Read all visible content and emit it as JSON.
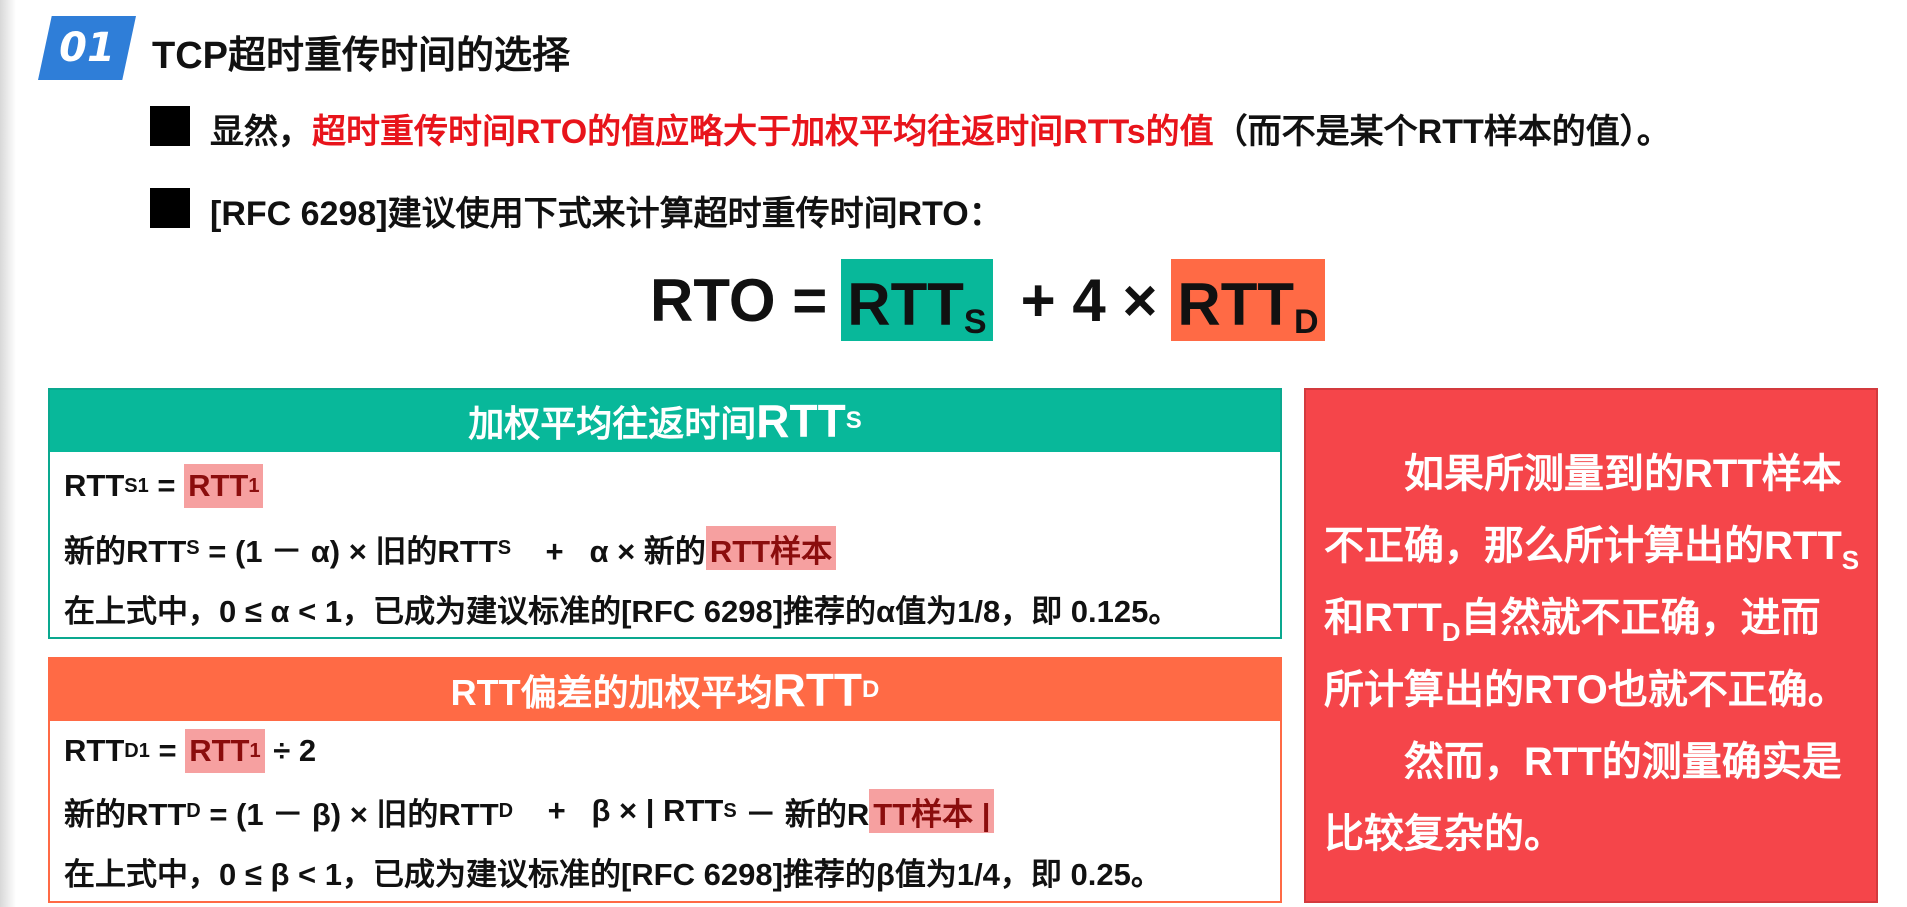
{
  "header": {
    "badge": "01",
    "title": "TCP超时重传时间的选择"
  },
  "bullet1": {
    "prefix": "显然，",
    "highlight": "超时重传时间RTO的值应略大于加权平均往返时间RTTs的值",
    "suffix": "（而不是某个RTT样本的值）。"
  },
  "bullet2": {
    "text": "[RFC 6298]建议使用下式来计算超时重传时间RTO："
  },
  "formula": {
    "lhs": "RTO =",
    "term1": "RTT",
    "term1_sub": "S",
    "mid": "+ 4 ×",
    "term2": "RTT",
    "term2_sub": "D"
  },
  "panel_rtts": {
    "title": "加权平均往返时间",
    "title_big": "RTT",
    "title_sub": "S",
    "row1": {
      "a": "RTT",
      "a_sub": "S1",
      "eq": " = ",
      "hl": "RTT",
      "hl_sub": "1"
    },
    "row2": {
      "a": "新的RTT",
      "a_sub": "S",
      "b": " = (1 － α) × 旧的RTT",
      "b_sub": "S",
      "c": "    +   α × 新的",
      "hl": "RTT样本"
    },
    "row3": "在上式中，0 ≤ α < 1，已成为建议标准的[RFC 6298]推荐的α值为1/8，即 0.125。"
  },
  "panel_rttd": {
    "title": "RTT偏差的加权平均",
    "title_big": "RTT",
    "title_sub": "D",
    "row1": {
      "a": "RTT",
      "a_sub": "D1",
      "eq": " = ",
      "hl": "RTT",
      "hl_sub": "1",
      "tail": " ÷ 2"
    },
    "row2": {
      "a": "新的RTT",
      "a_sub": "D",
      "b": " = (1 － β) × 旧的RTT",
      "b_sub": "D",
      "c": "    +   β × | RTT",
      "c_sub": "S",
      "d": " － 新的R",
      "hl": "TT样本 |"
    },
    "row3": "在上式中，0 ≤ β < 1，已成为建议标准的[RFC 6298]推荐的β值为1/4，即 0.25。"
  },
  "note": {
    "p1_a": "如果所测量到的RTT样本不正确，那么所计算出的RTT",
    "p1_sub1": "S",
    "p1_b": "和RTT",
    "p1_sub2": "D",
    "p1_c": "自然就不正确，进而所计算出的RTO也就不正确。",
    "p2": "然而，RTT的测量确实是比较复杂的。"
  },
  "colors": {
    "badge": "#2f7ed8",
    "teal": "#08b89a",
    "orange": "#ff6a45",
    "red_text": "#e8141b",
    "note_bg": "#f5454a",
    "highlight": "#f6a0a0"
  }
}
